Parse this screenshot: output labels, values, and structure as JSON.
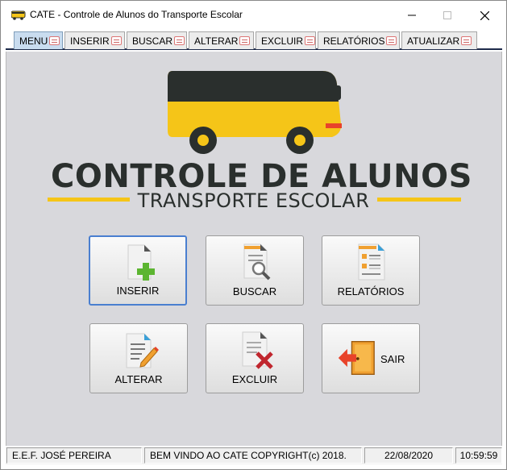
{
  "window": {
    "title": "CATE - Controle de Alunos do Transporte Escolar"
  },
  "tabs": [
    {
      "label": "MENU",
      "icon": "menu-icon",
      "active": true
    },
    {
      "label": "INSERIR",
      "icon": "insert-icon"
    },
    {
      "label": "BUSCAR",
      "icon": "search-icon"
    },
    {
      "label": "ALTERAR",
      "icon": "edit-icon"
    },
    {
      "label": "EXCLUIR",
      "icon": "delete-icon"
    },
    {
      "label": "RELATÓRIOS",
      "icon": "report-icon"
    },
    {
      "label": "ATUALIZAR",
      "icon": "refresh-icon"
    }
  ],
  "logo": {
    "title": "CONTROLE DE ALUNOS",
    "subtitle": "TRANSPORTE ESCOLAR",
    "colors": {
      "accent": "#f5c518",
      "dark": "#2a2f2d",
      "bus_red": "#e8432a"
    }
  },
  "menu_buttons": {
    "inserir": "INSERIR",
    "buscar": "BUSCAR",
    "relatorios": "RELATÓRIOS",
    "alterar": "ALTERAR",
    "excluir": "EXCLUIR",
    "sair": "SAIR"
  },
  "status": {
    "school": "E.E.F. JOSÉ PEREIRA",
    "message": "BEM VINDO AO CATE COPYRIGHT(c) 2018.",
    "date": "22/08/2020",
    "time": "10:59:59"
  }
}
